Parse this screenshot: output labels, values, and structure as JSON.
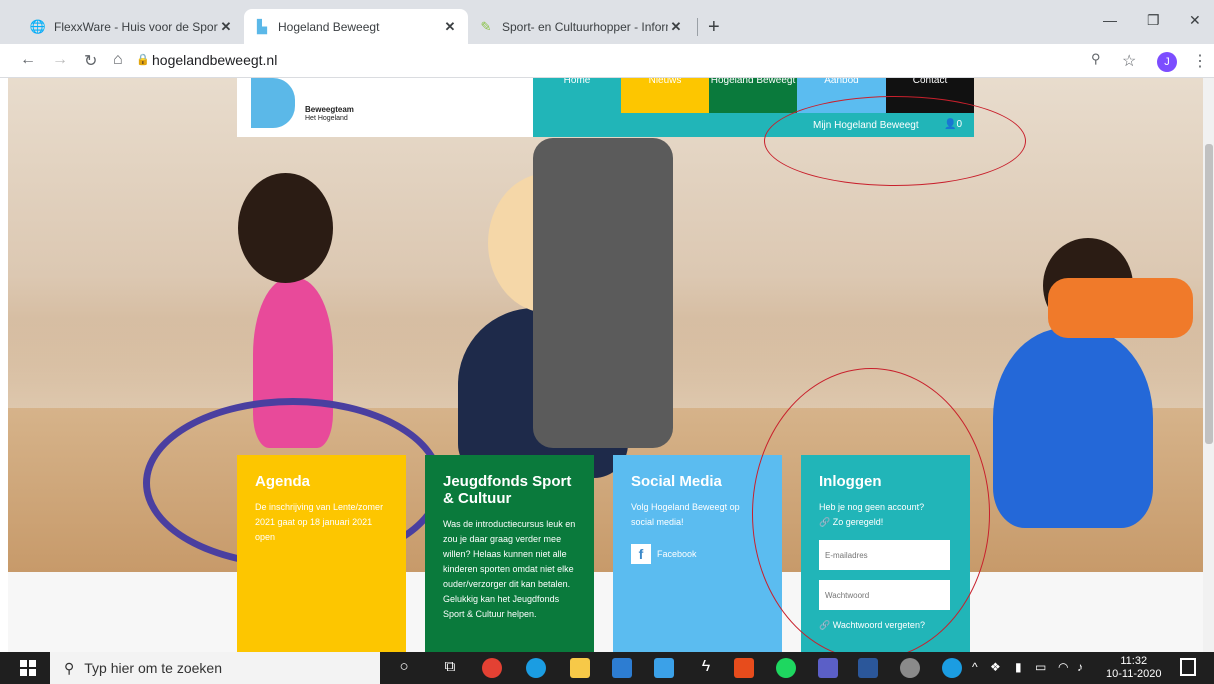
{
  "browser": {
    "tabs": [
      {
        "label": "FlexxWare - Huis voor de Sport &",
        "icon": "globe-icon",
        "active": false
      },
      {
        "label": "Hogeland Beweegt",
        "icon": "site-logo-icon",
        "active": true
      },
      {
        "label": "Sport- en Cultuurhopper - Inform",
        "icon": "leaf-icon",
        "active": false
      }
    ],
    "url": "hogelandbeweegt.nl",
    "avatar_letter": "J"
  },
  "site": {
    "logo_line1": "Beweegteam",
    "logo_line2": "Het Hogeland",
    "nav": [
      "Home",
      "Nieuws",
      "Hogeland Beweegt",
      "Aanbod",
      "Contact"
    ],
    "mijn_label": "Mijn Hogeland Beweegt",
    "mijn_count": "0",
    "cards": {
      "agenda": {
        "title": "Agenda",
        "text": "De inschrijving van Lente/zomer 2021 gaat op 18 januari 2021 open"
      },
      "jeugdfonds": {
        "title": "Jeugdfonds Sport & Cultuur",
        "text": "Was de introductiecursus leuk en zou je daar graag verder mee willen? Helaas kunnen niet alle kinderen sporten omdat niet elke ouder/verzorger dit kan betalen. Gelukkig kan het Jeugdfonds Sport & Cultuur helpen."
      },
      "social": {
        "title": "Social Media",
        "text": "Volg Hogeland Beweegt op social media!",
        "facebook": "Facebook"
      },
      "login": {
        "title": "Inloggen",
        "no_account": "Heb je nog geen account?",
        "register": "Zo geregeld!",
        "email_placeholder": "E-mailadres",
        "password_placeholder": "Wachtwoord",
        "forgot": "Wachtwoord vergeten?"
      }
    },
    "colors": {
      "agenda": "#fdc600",
      "jeugdfonds": "#0a7a3c",
      "social": "#5bbcf0",
      "login": "#21b5b8"
    }
  },
  "taskbar": {
    "search_placeholder": "Typ hier om te zoeken",
    "time": "11:32",
    "date": "10-11-2020"
  }
}
